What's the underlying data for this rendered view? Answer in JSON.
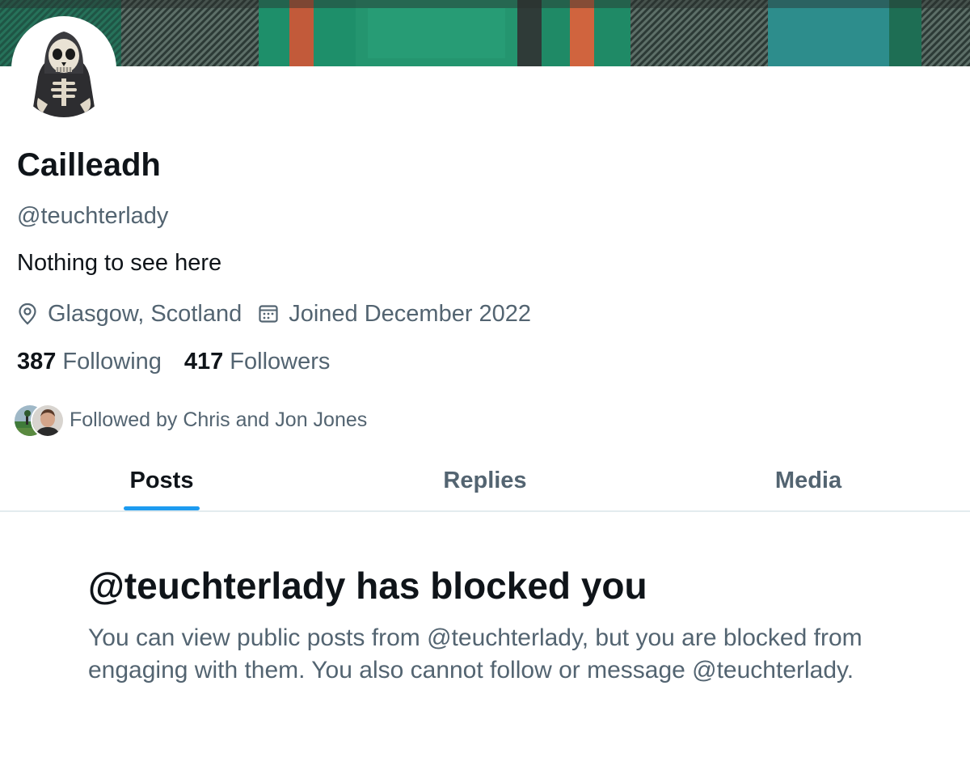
{
  "profile": {
    "display_name": "Cailleadh",
    "handle": "@teuchterlady",
    "bio": "Nothing to see here",
    "location": "Glasgow, Scotland",
    "joined": "Joined December 2022",
    "following_count": "387",
    "following_label": "Following",
    "followers_count": "417",
    "followers_label": "Followers",
    "followed_by": "Followed by Chris and Jon Jones"
  },
  "tabs": [
    {
      "label": "Posts",
      "active": true
    },
    {
      "label": "Replies",
      "active": false
    },
    {
      "label": "Media",
      "active": false
    }
  ],
  "blocked": {
    "title": "@teuchterlady has blocked you",
    "body": "You can view public posts from @teuchterlady, but you are blocked from engaging with them. You also cannot follow or message @teuchterlady."
  },
  "icons": {
    "location": "map-pin-icon",
    "joined": "calendar-icon"
  },
  "colors": {
    "accent": "#1d9bf0",
    "text_primary": "#0f1419",
    "text_secondary": "#536471",
    "divider": "#e3ecef"
  }
}
